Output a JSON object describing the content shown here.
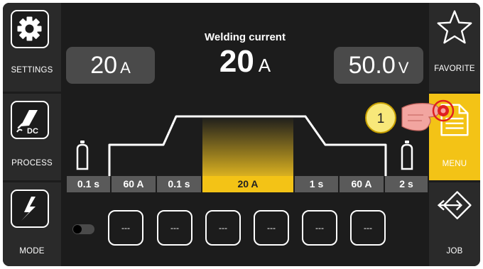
{
  "left_sidebar": {
    "settings_label": "SETTINGS",
    "process_label": "PROCESS",
    "process_badge": "DC",
    "mode_label": "MODE"
  },
  "right_sidebar": {
    "favorite_label": "FAVORITE",
    "menu_label": "MENU",
    "job_label": "JOB"
  },
  "main": {
    "title": "Welding current",
    "current_value": "20",
    "current_unit": "A",
    "left_box": {
      "value": "20",
      "unit": "A"
    },
    "right_box": {
      "value": "50.0",
      "unit": "V"
    },
    "callout": "1",
    "segments": [
      "0.1 s",
      "60 A",
      "0.1 s",
      "20 A",
      "1 s",
      "60 A",
      "2 s"
    ],
    "active_segment": "20 A",
    "job_slots": [
      "---",
      "---",
      "---",
      "---",
      "---",
      "---"
    ]
  },
  "colors": {
    "accent": "#f3c316",
    "background": "#1c1c1c",
    "sidebar": "#2a2a2a",
    "value_box": "#4a4a4a",
    "hand_pink": "#f2a5a0",
    "touch_red": "#e02020"
  },
  "icons": {
    "settings": "gear-icon",
    "process": "welding-torch-icon",
    "mode": "lightning-bolt-icon",
    "favorite": "star-icon",
    "menu": "document-icon",
    "job": "swap-arrows-icon",
    "gas_left": "gas-cylinder-icon",
    "gas_right": "gas-cylinder-icon"
  }
}
